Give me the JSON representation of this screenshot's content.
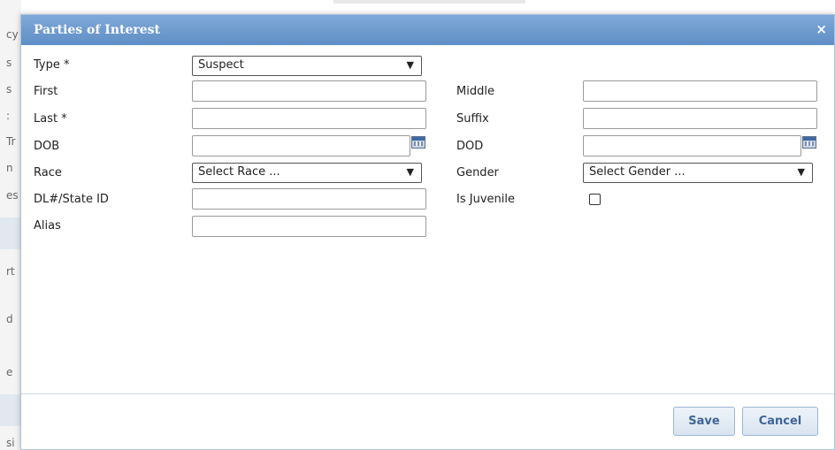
{
  "background": {
    "fragments": [
      "cy",
      "s",
      "s",
      ":",
      "Tr",
      "n",
      "es",
      "rt",
      "d",
      "e",
      "si"
    ]
  },
  "dialog": {
    "title": "Parties of Interest",
    "close_glyph": "×",
    "fields": {
      "type": {
        "label": "Type *",
        "value": "Suspect"
      },
      "first": {
        "label": "First",
        "value": ""
      },
      "middle": {
        "label": "Middle",
        "value": ""
      },
      "last": {
        "label": "Last *",
        "value": ""
      },
      "suffix": {
        "label": "Suffix",
        "value": ""
      },
      "dob": {
        "label": "DOB",
        "value": ""
      },
      "dod": {
        "label": "DOD",
        "value": ""
      },
      "race": {
        "label": "Race",
        "value": "Select Race ..."
      },
      "gender": {
        "label": "Gender",
        "value": "Select Gender ..."
      },
      "dl_state_id": {
        "label": "DL#/State ID",
        "value": ""
      },
      "is_juvenile": {
        "label": "Is Juvenile",
        "checked": false
      },
      "alias": {
        "label": "Alias",
        "value": ""
      }
    },
    "buttons": {
      "save": "Save",
      "cancel": "Cancel"
    }
  },
  "icons": {
    "calendar": "calendar-icon",
    "close": "close-icon",
    "dropdown": "chevron-down-icon"
  }
}
